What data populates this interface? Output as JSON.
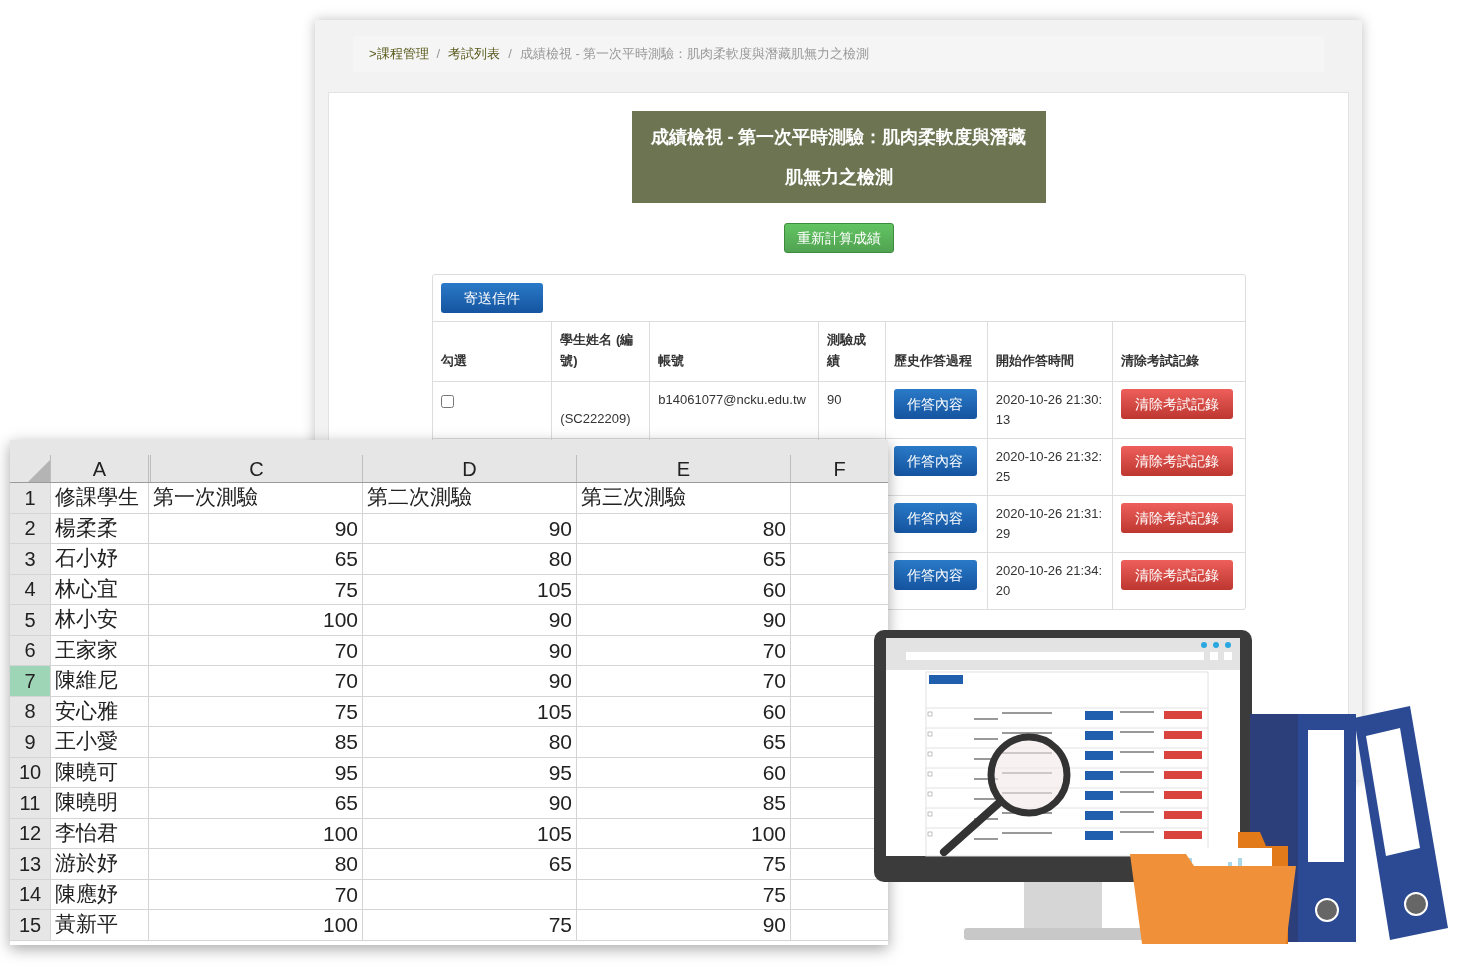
{
  "page": {
    "breadcrumb_separator": "/",
    "breadcrumb": [
      {
        "label": ">課程管理",
        "current": false
      },
      {
        "label": "考試列表",
        "current": false
      },
      {
        "label": "成績檢視 - 第一次平時測驗：肌肉柔軟度與潛藏肌無力之檢測",
        "current": true
      }
    ],
    "title": "成績檢視 - 第一次平時測驗：肌肉柔軟度與潛藏肌無力之檢測",
    "recalculate_button": "重新計算成績",
    "send_mail_button": "寄送信件",
    "table": {
      "columns": [
        "勾選",
        "學生姓名 (編號)",
        "帳號",
        "測驗成績",
        "歷史作答過程",
        "開始作答時間",
        "清除考試記錄"
      ],
      "rows": [
        {
          "checked": false,
          "student": "(SC222209)",
          "account": "b14061077@ncku.edu.tw",
          "score": "90",
          "history_button": "作答內容",
          "start_time": "2020-10-26 21:30:13",
          "clear_button": "清除考試記錄"
        },
        {
          "history_button": "作答內容",
          "start_time": "2020-10-26 21:32:25",
          "clear_button": "清除考試記錄"
        },
        {
          "history_button": "作答內容",
          "start_time": "2020-10-26 21:31:29",
          "clear_button": "清除考試記錄"
        },
        {
          "history_button": "作答內容",
          "start_time": "2020-10-26 21:34:20",
          "clear_button": "清除考試記錄"
        }
      ]
    }
  },
  "spreadsheet": {
    "columns": [
      "A",
      "C",
      "D",
      "E",
      "F"
    ],
    "rows": [
      {
        "number": "1",
        "selected": false,
        "cells": [
          "修課學生",
          "第一次測驗",
          "第二次測驗",
          "第三次測驗"
        ]
      },
      {
        "number": "2",
        "selected": false,
        "cells": [
          "楊柔柔",
          "90",
          "90",
          "80"
        ]
      },
      {
        "number": "3",
        "selected": false,
        "cells": [
          "石小妤",
          "65",
          "80",
          "65"
        ]
      },
      {
        "number": "4",
        "selected": false,
        "cells": [
          "林心宜",
          "75",
          "105",
          "60"
        ]
      },
      {
        "number": "5",
        "selected": false,
        "cells": [
          "林小安",
          "100",
          "90",
          "90"
        ]
      },
      {
        "number": "6",
        "selected": false,
        "cells": [
          "王家家",
          "70",
          "90",
          "70"
        ]
      },
      {
        "number": "7",
        "selected": true,
        "cells": [
          "陳維尼",
          "70",
          "90",
          "70"
        ]
      },
      {
        "number": "8",
        "selected": false,
        "cells": [
          "安心雅",
          "75",
          "105",
          "60"
        ]
      },
      {
        "number": "9",
        "selected": false,
        "cells": [
          "王小愛",
          "85",
          "80",
          "65"
        ]
      },
      {
        "number": "10",
        "selected": false,
        "cells": [
          "陳曉可",
          "95",
          "95",
          "60"
        ]
      },
      {
        "number": "11",
        "selected": false,
        "cells": [
          "陳曉明",
          "65",
          "90",
          "85"
        ]
      },
      {
        "number": "12",
        "selected": false,
        "cells": [
          "李怡君",
          "100",
          "105",
          "100"
        ]
      },
      {
        "number": "13",
        "selected": false,
        "cells": [
          "游於妤",
          "80",
          "65",
          "75"
        ]
      },
      {
        "number": "14",
        "selected": false,
        "cells": [
          "陳應妤",
          "70",
          null,
          "75"
        ]
      },
      {
        "number": "15",
        "selected": false,
        "cells": [
          "黃新平",
          "100",
          "75",
          "90"
        ]
      }
    ]
  }
}
